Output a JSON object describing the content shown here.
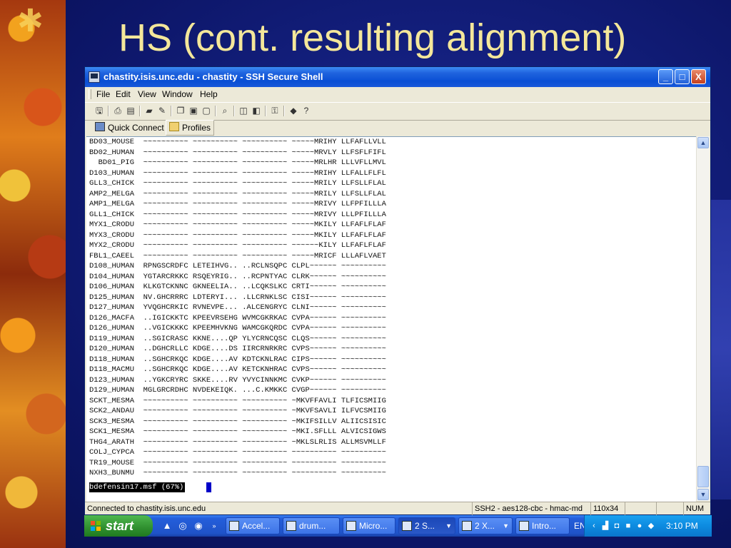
{
  "slide": {
    "title": "HS (cont. resulting alignment)"
  },
  "window": {
    "title": "chastity.isis.unc.edu - chastity - SSH Secure Shell",
    "controls": {
      "minimize": "_",
      "maximize": "□",
      "close": "X"
    }
  },
  "menu": {
    "file": "File",
    "edit": "Edit",
    "view": "View",
    "window": "Window",
    "help": "Help"
  },
  "quick_bar": {
    "quick_connect": "Quick Connect",
    "profiles": "Profiles"
  },
  "terminal": {
    "lines": [
      "BD03_MOUSE  ~~~~~~~~~~ ~~~~~~~~~~ ~~~~~~~~~~ ~~~~~MRIHY LLFAFLLVLL",
      "BD02_HUMAN  ~~~~~~~~~~ ~~~~~~~~~~ ~~~~~~~~~~ ~~~~~MRVLY LLFSFLFIFL",
      "  BD01_PIG  ~~~~~~~~~~ ~~~~~~~~~~ ~~~~~~~~~~ ~~~~~MRLHR LLLVFLLMVL",
      "D103_HUMAN  ~~~~~~~~~~ ~~~~~~~~~~ ~~~~~~~~~~ ~~~~~MRIHY LLFALLFLFL",
      "GLL3_CHICK  ~~~~~~~~~~ ~~~~~~~~~~ ~~~~~~~~~~ ~~~~~MRILY LLFSLLFLAL",
      "AMP2_MELGA  ~~~~~~~~~~ ~~~~~~~~~~ ~~~~~~~~~~ ~~~~~MRILY LLFSLLFLAL",
      "AMP1_MELGA  ~~~~~~~~~~ ~~~~~~~~~~ ~~~~~~~~~~ ~~~~~MRIVY LLFPFILLLA",
      "GLL1_CHICK  ~~~~~~~~~~ ~~~~~~~~~~ ~~~~~~~~~~ ~~~~~MRIVY LLLPFILLLA",
      "MYX1_CRODU  ~~~~~~~~~~ ~~~~~~~~~~ ~~~~~~~~~~ ~~~~~MKILY LLFAFLFLAF",
      "MYX3_CRODU  ~~~~~~~~~~ ~~~~~~~~~~ ~~~~~~~~~~ ~~~~~MKILY LLFAFLFLAF",
      "MYX2_CRODU  ~~~~~~~~~~ ~~~~~~~~~~ ~~~~~~~~~~ ~~~~~~KILY LLFAFLFLAF",
      "FBL1_CAEEL  ~~~~~~~~~~ ~~~~~~~~~~ ~~~~~~~~~~ ~~~~~MRICF LLLAFLVAET",
      "D108_HUMAN  RPNGSCRDFC LETEIHVG.. ..RCLNSQPC CLPL~~~~~~ ~~~~~~~~~~",
      "D104_HUMAN  YGTARCRKKC RSQEYRIG.. ..RCPNTYAC CLRK~~~~~~ ~~~~~~~~~~",
      "D106_HUMAN  KLKGTCKNNC GKNEELIA.. ..LCQKSLKC CRTI~~~~~~ ~~~~~~~~~~",
      "D125_HUMAN  NV.GHCRRRC LDTERYI... .LLCRNKLSC CISI~~~~~~ ~~~~~~~~~~",
      "D127_HUMAN  YVQGHCRKIC RVNEVPE... .ALCENGRYC CLNI~~~~~~ ~~~~~~~~~~",
      "D126_MACFA  ..IGICKKTC KPEEVRSEHG WVMCGKRKAC CVPA~~~~~~ ~~~~~~~~~~",
      "D126_HUMAN  ..VGICKKKC KPEEMHVKNG WAMCGKQRDC CVPA~~~~~~ ~~~~~~~~~~",
      "D119_HUMAN  ..SGICRASC KKNE....QP YLYCRNCQSC CLQS~~~~~~ ~~~~~~~~~~",
      "D120_HUMAN  ..DGHCRLLC KDGE....DS IIRCRNRKRC CVPS~~~~~~ ~~~~~~~~~~",
      "D118_HUMAN  ..SGHCRKQC KDGE....AV KDTCKNLRAC CIPS~~~~~~ ~~~~~~~~~~",
      "D118_MACMU  ..SGHCRKQC KDGE....AV KETCKNHRAC CVPS~~~~~~ ~~~~~~~~~~",
      "D123_HUMAN  ..YGKCRYRC SKKE....RV YVYCINNKMC CVKP~~~~~~ ~~~~~~~~~~",
      "D129_HUMAN  MGLGRCRDHC NVDEKEIQK. ...C.KMKKC CVGP~~~~~~ ~~~~~~~~~~",
      "SCKT_MESMA  ~~~~~~~~~~ ~~~~~~~~~~ ~~~~~~~~~~ ~MKVFFAVLI TLFICSMIIG",
      "SCK2_ANDAU  ~~~~~~~~~~ ~~~~~~~~~~ ~~~~~~~~~~ ~MKVFSAVLI ILFVCSMIIG",
      "SCK3_MESMA  ~~~~~~~~~~ ~~~~~~~~~~ ~~~~~~~~~~ ~MKIFSILLV ALIICSISIC",
      "SCK1_MESMA  ~~~~~~~~~~ ~~~~~~~~~~ ~~~~~~~~~~ ~MKI.SFLLL ALVICSIGWS",
      "THG4_ARATH  ~~~~~~~~~~ ~~~~~~~~~~ ~~~~~~~~~~ ~MKLSLRLIS ALLMSVMLLF",
      "COLJ_CYPCA  ~~~~~~~~~~ ~~~~~~~~~~ ~~~~~~~~~~ ~~~~~~~~~~ ~~~~~~~~~~",
      "TR19_MOUSE  ~~~~~~~~~~ ~~~~~~~~~~ ~~~~~~~~~~ ~~~~~~~~~~ ~~~~~~~~~~",
      "NXH3_BUNMU  ~~~~~~~~~~ ~~~~~~~~~~ ~~~~~~~~~~ ~~~~~~~~~~ ~~~~~~~~~~"
    ],
    "status_line": "bdefensin17.msf (67%)"
  },
  "statusbar": {
    "connection": "Connected to chastity.isis.unc.edu",
    "cipher": "SSH2 - aes128-cbc - hmac-md",
    "size": "110x34",
    "num": "NUM"
  },
  "taskbar": {
    "start_label": "start",
    "tasks": [
      {
        "label": "Accel..."
      },
      {
        "label": "drum..."
      },
      {
        "label": "Micro..."
      },
      {
        "label": "2 S..."
      },
      {
        "label": "2 X..."
      },
      {
        "label": "Intro..."
      }
    ],
    "language": "EN",
    "clock": "3:10 PM"
  },
  "colors": {
    "slide_background": "#0f1c73",
    "title_text": "#f4e79a",
    "titlebar_blue": "#0a4fd4",
    "taskbar_blue": "#245edb",
    "start_green": "#2f8f2f"
  },
  "icons": {
    "toolbar": [
      "save-icon",
      "print-icon",
      "print-preview-icon",
      "disconnect-icon",
      "settings-icon",
      "copy-icon",
      "paste-icon",
      "paste-alt-icon",
      "find-icon",
      "new-terminal-icon",
      "new-file-transfer-icon",
      "keys-icon",
      "help-contents-icon",
      "whats-this-icon"
    ]
  }
}
